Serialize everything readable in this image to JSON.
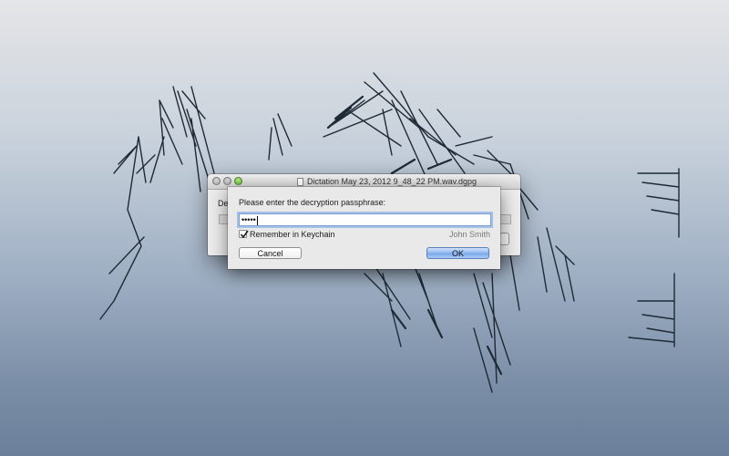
{
  "window": {
    "title": "Dictation May 23, 2012 9_48_22 PM.wav.dgpg",
    "peek_label": "De"
  },
  "sheet": {
    "prompt": "Please enter the decryption passphrase:",
    "passphrase_masked": "•••••",
    "remember_label": "Remember in Keychain",
    "remember_checked": true,
    "user_name": "John Smith",
    "cancel_label": "Cancel",
    "ok_label": "OK"
  },
  "icons": {
    "window_document": "document-icon",
    "traffic_lights": [
      "close-icon",
      "minimize-icon",
      "zoom-icon"
    ],
    "checkbox": "checkmark-icon"
  },
  "colors": {
    "default_button": "#77a6ea",
    "focus_ring": "#7c9fd3"
  }
}
